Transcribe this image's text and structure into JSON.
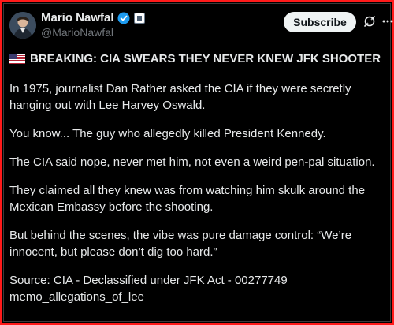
{
  "post": {
    "author": {
      "display_name": "Mario Nawfal",
      "handle": "@MarioNawfal",
      "verified_icon": "verified-badge-icon",
      "affiliation_icon": "affiliate-badge-icon"
    },
    "subscribe_label": "Subscribe",
    "headline": "BREAKING: CIA SWEARS THEY NEVER KNEW JFK SHOOTER",
    "paragraphs": [
      "In 1975, journalist Dan Rather asked the CIA if they were secretly hanging out with Lee Harvey Oswald.",
      "You know... The guy who allegedly killed President Kennedy.",
      "The CIA said nope, never met him, not even a weird pen-pal situation.",
      "They claimed all they knew was from watching him skulk around the Mexican Embassy before the shooting.",
      "But behind the scenes, the vibe was pure damage control: “We’re innocent, but please don’t dig too hard.”",
      "Source: CIA - Declassified under JFK Act - 00277749 memo_allegations_of_lee"
    ]
  },
  "colors": {
    "background": "#000000",
    "text": "#e7e9ea",
    "muted": "#71767b",
    "verified": "#1d9bf0",
    "subscribe_bg": "#eff3f4",
    "frame": "#ff1a1a"
  },
  "icons": [
    "avatar",
    "verified-badge-icon",
    "affiliate-badge-icon",
    "grok-icon",
    "more-options-icon",
    "us-flag-icon"
  ]
}
